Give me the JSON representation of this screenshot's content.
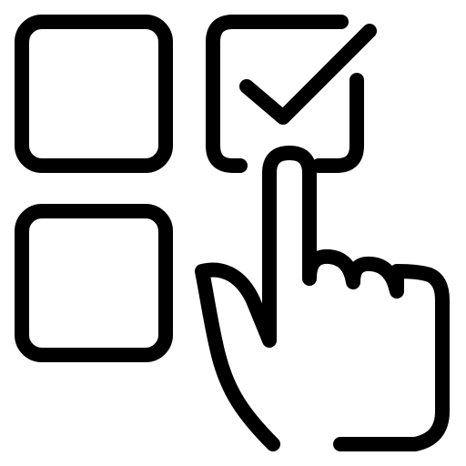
{
  "icon": {
    "name": "select-checkbox-with-pointing-hand-icon",
    "stroke_color": "#000000",
    "background_color": "#ffffff",
    "parts": [
      "checkbox-empty-top-left-icon",
      "checkbox-checked-top-right-icon",
      "checkmark-icon",
      "checkbox-empty-bottom-left-icon",
      "pointing-hand-icon"
    ]
  }
}
